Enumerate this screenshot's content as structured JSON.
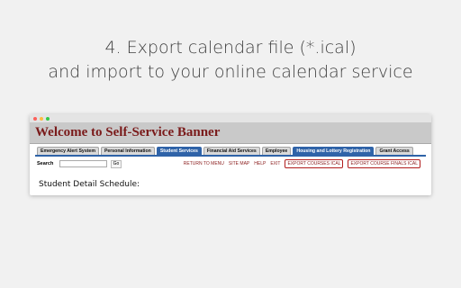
{
  "headline": {
    "line1": "4. Export calendar file (*.ical)",
    "line2": "and import to your online calendar service"
  },
  "banner": {
    "title": "Welcome to Self-Service Banner"
  },
  "tabs": [
    {
      "label": "Emergency Alert System"
    },
    {
      "label": "Personal Information"
    },
    {
      "label": "Student Services"
    },
    {
      "label": "Financial Aid Services"
    },
    {
      "label": "Employee"
    },
    {
      "label": "Housing and Lottery Registration"
    },
    {
      "label": "Grant Access"
    }
  ],
  "toolbar": {
    "search_label": "Search",
    "go_label": "Go",
    "links": [
      {
        "label": "RETURN TO MENU"
      },
      {
        "label": "SITE MAP"
      },
      {
        "label": "HELP"
      },
      {
        "label": "EXIT"
      },
      {
        "label": "EXPORT COURSES ICAL"
      },
      {
        "label": "EXPORT COURSE FINALS ICAL"
      }
    ]
  },
  "page": {
    "heading": "Student Detail Schedule:"
  },
  "colors": {
    "background": "#f1f1f1",
    "banner_title": "#7a1a1a",
    "active_tab": "#2f63a8",
    "link": "#8a1b1b",
    "highlight": "#b11c1c"
  }
}
